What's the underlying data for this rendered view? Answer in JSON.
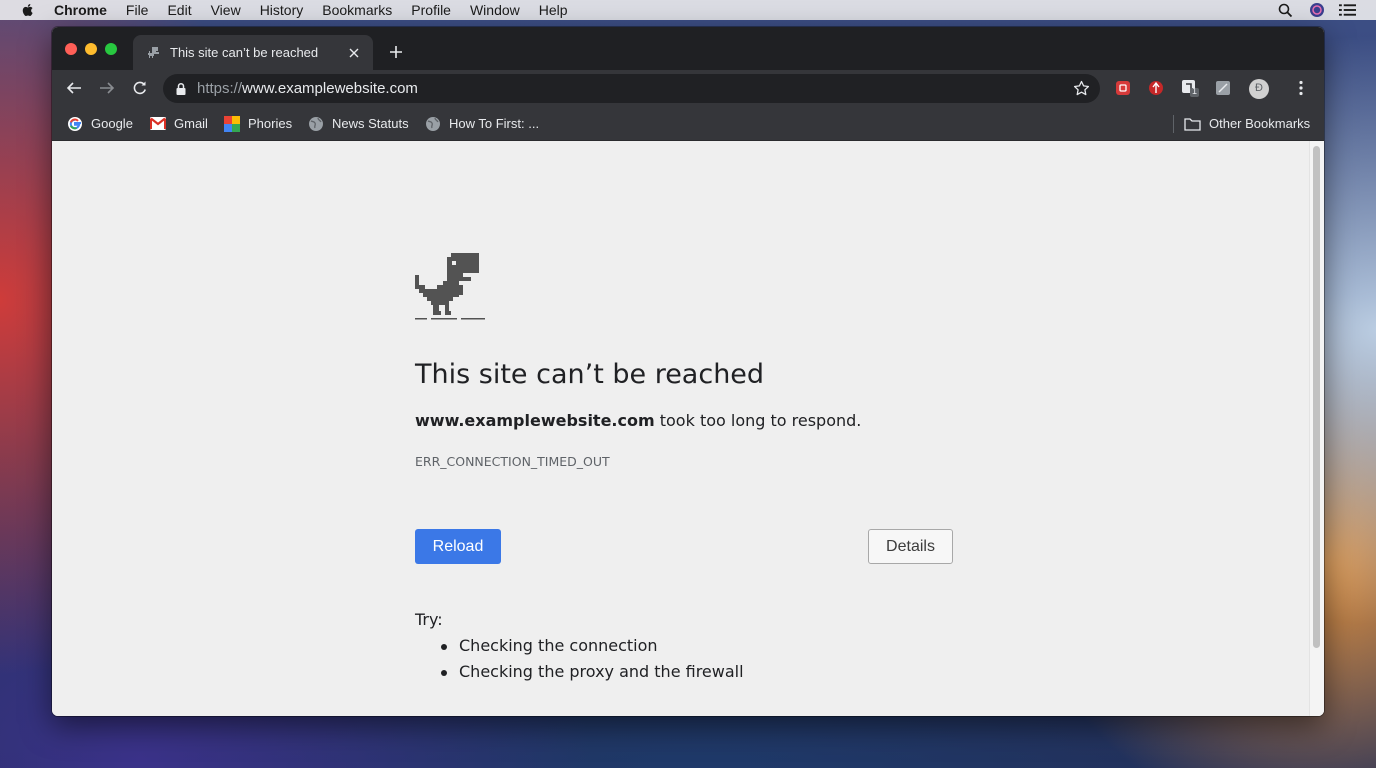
{
  "menubar": {
    "app": "Chrome",
    "items": [
      "File",
      "Edit",
      "View",
      "History",
      "Bookmarks",
      "Profile",
      "Window",
      "Help"
    ]
  },
  "tab": {
    "title": "This site can’t be reached"
  },
  "omnibox": {
    "scheme": "https://",
    "host": "www.examplewebsite.com"
  },
  "bookmarks": {
    "items": [
      "Google",
      "Gmail",
      "Phories",
      "News Statuts",
      "How To First: ..."
    ],
    "other": "Other Bookmarks"
  },
  "extensions": {
    "badge": "1",
    "profile_initial": "Ð"
  },
  "error": {
    "title": "This site can’t be reached",
    "host": "www.examplewebsite.com",
    "message": " took too long to respond.",
    "code": "ERR_CONNECTION_TIMED_OUT",
    "reload_label": "Reload",
    "details_label": "Details",
    "try_label": "Try:",
    "suggestions": [
      "Checking the connection",
      "Checking the proxy and the firewall"
    ]
  },
  "colors": {
    "reload_button": "#3b78e7",
    "toolbar": "#35363a",
    "titlebar": "#1f2023",
    "page_bg": "#efefef"
  }
}
